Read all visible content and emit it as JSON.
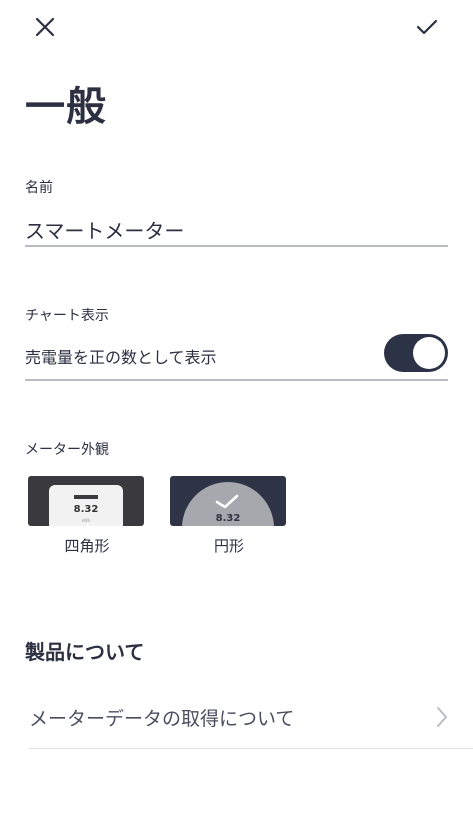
{
  "header": {
    "close_icon": "close-icon",
    "confirm_icon": "checkmark-icon"
  },
  "page": {
    "title": "一般"
  },
  "name_section": {
    "label": "名前",
    "value": "スマートメーター"
  },
  "chart_section": {
    "label": "チャート表示",
    "toggle_label": "売電量を正の数として表示",
    "toggle_on": true
  },
  "meter_section": {
    "label": "メーター外観",
    "options": [
      {
        "name": "四角形",
        "preview_value": "8.32",
        "preview_unit": "kWh"
      },
      {
        "name": "円形",
        "preview_value": "8.32"
      }
    ]
  },
  "about_section": {
    "heading": "製品について",
    "row_label": "メーターデータの取得について",
    "row_icon": "chevron-right-icon"
  },
  "colors": {
    "text": "#2c3041",
    "toggle_on": "#2d3346",
    "divider": "#b9bcc2",
    "thumb_dark": "#3a3a3e",
    "thumb_navy": "#2f3346"
  }
}
